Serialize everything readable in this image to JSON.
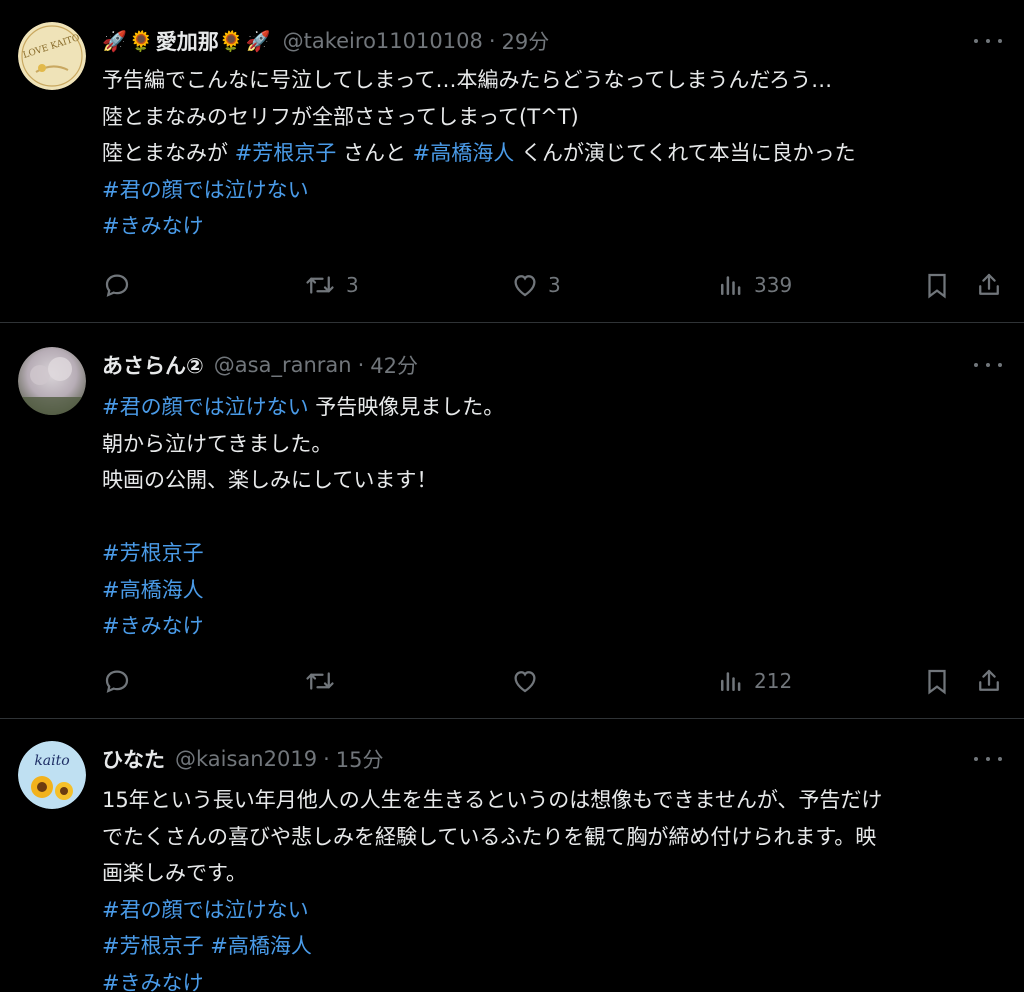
{
  "tweets": [
    {
      "name": "愛加那",
      "name_emojis_left": [
        "🚀",
        "🌻"
      ],
      "name_emojis_right": [
        "🌻",
        "🚀"
      ],
      "handle": "@takeiro11010108",
      "dot": "·",
      "time": "29分",
      "avatar_text": "LOVE KAITO",
      "lines": [
        [
          {
            "t": "予告編でこんなに号泣してしまって…本編みたらどうなってしまうんだろう…"
          }
        ],
        [
          {
            "t": "陸とまなみのセリフが全部ささってしまって(T^T)"
          }
        ],
        [
          {
            "t": "陸とまなみが "
          },
          {
            "t": "#芳根京子",
            "tag": true
          },
          {
            "t": " さんと "
          },
          {
            "t": "#高橋海人",
            "tag": true
          },
          {
            "t": " くんが演じてくれて本当に良かった"
          }
        ],
        [
          {
            "t": " "
          },
          {
            "t": "#君の顔では泣けない",
            "tag": true
          }
        ],
        [
          {
            "t": " "
          },
          {
            "t": "#きみなけ",
            "tag": true
          }
        ]
      ],
      "actions": {
        "reply": "",
        "retweet": "3",
        "like": "3",
        "views": "339"
      }
    },
    {
      "name": "あさらん②",
      "handle": "@asa_ranran",
      "dot": "·",
      "time": "42分",
      "lines": [
        [
          {
            "t": "#君の顔では泣けない",
            "tag": true
          },
          {
            "t": " 予告映像見ました。"
          }
        ],
        [
          {
            "t": "朝から泣けてきました。"
          }
        ],
        [
          {
            "t": "映画の公開、楽しみにしています！"
          }
        ],
        [],
        [
          {
            "t": "#芳根京子",
            "tag": true
          }
        ],
        [
          {
            "t": "#高橋海人",
            "tag": true
          }
        ],
        [
          {
            "t": "#きみなけ",
            "tag": true
          }
        ]
      ],
      "actions": {
        "reply": "",
        "retweet": "",
        "like": "",
        "views": "212"
      }
    },
    {
      "name": "ひなた",
      "handle": "@kaisan2019",
      "dot": "·",
      "time": "15分",
      "avatar_text": "kaito",
      "lines": [
        [
          {
            "t": "15年という長い年月他人の人生を生きるというのは想像もできませんが、予告だけ"
          }
        ],
        [
          {
            "t": "でたくさんの喜びや悲しみを経験しているふたりを観て胸が締め付けられます。映"
          }
        ],
        [
          {
            "t": "画楽しみです。"
          }
        ],
        [
          {
            "t": "#君の顔では泣けない",
            "tag": true
          }
        ],
        [
          {
            "t": "#芳根京子",
            "tag": true
          },
          {
            "t": " "
          },
          {
            "t": "#高橋海人",
            "tag": true
          }
        ],
        [
          {
            "t": "#きみなけ",
            "tag": true
          }
        ]
      ]
    }
  ],
  "colors": {
    "background": "#000000",
    "text": "#e7e9ea",
    "muted": "#71767b",
    "hashtag": "#4a9be8",
    "divider": "#2f3336"
  },
  "icons": [
    "reply-icon",
    "retweet-icon",
    "like-icon",
    "views-icon",
    "bookmark-icon",
    "share-icon",
    "more-icon"
  ]
}
